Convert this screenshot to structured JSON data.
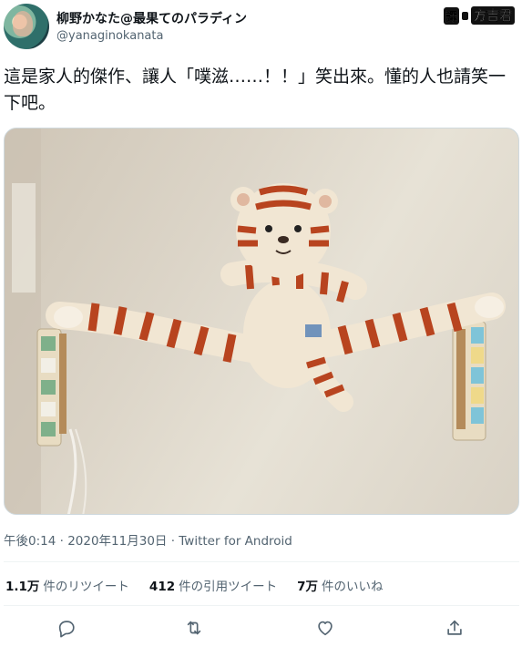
{
  "author": {
    "display_name": "柳野かなた@最果てのパラディン",
    "handle": "@yanaginokanata"
  },
  "watermark": {
    "part1": "譯",
    "part2": "方吉君"
  },
  "tweet": {
    "text": "這是家人的傑作、讓人「噗滋……！！」笑出來。懂的人也請笑一下吧。"
  },
  "photo": {
    "icon": "photo-stuffed-tiger-on-wall",
    "colors": {
      "stripe": "#b8441f",
      "fur": "#f1e6d3",
      "wall": "#ddd6c9"
    }
  },
  "meta": {
    "timestamp": "午後0:14 · 2020年11月30日 · Twitter for Android"
  },
  "stats": [
    {
      "num": "1.1万",
      "label": "件のリツイート"
    },
    {
      "num": "412",
      "label": "件の引用ツイート"
    },
    {
      "num": "7万",
      "label": "件のいいね"
    }
  ],
  "actions": [
    {
      "icon": "reply-icon"
    },
    {
      "icon": "retweet-icon"
    },
    {
      "icon": "like-icon"
    },
    {
      "icon": "share-icon"
    }
  ]
}
